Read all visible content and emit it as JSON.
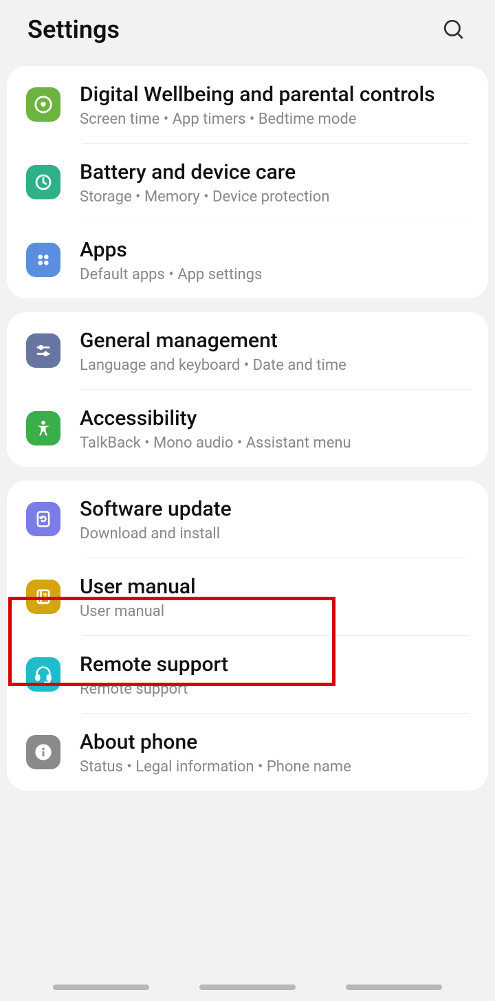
{
  "header": {
    "title": "Settings"
  },
  "groups": [
    {
      "items": [
        {
          "id": "digital-wellbeing",
          "title": "Digital Wellbeing and parental controls",
          "subtitle": "Screen time  •  App timers  •  Bedtime mode",
          "iconColor": "ic-green",
          "iconName": "wellbeing-icon"
        },
        {
          "id": "battery-care",
          "title": "Battery and device care",
          "subtitle": "Storage  •  Memory  •  Device protection",
          "iconColor": "ic-teal-dark",
          "iconName": "battery-icon"
        },
        {
          "id": "apps",
          "title": "Apps",
          "subtitle": "Default apps  •  App settings",
          "iconColor": "ic-blue",
          "iconName": "apps-icon"
        }
      ]
    },
    {
      "items": [
        {
          "id": "general-management",
          "title": "General management",
          "subtitle": "Language and keyboard  •  Date and time",
          "iconColor": "ic-gray-blue",
          "iconName": "sliders-icon"
        },
        {
          "id": "accessibility",
          "title": "Accessibility",
          "subtitle": "TalkBack  •  Mono audio  •  Assistant menu",
          "iconColor": "ic-green2",
          "iconName": "accessibility-icon"
        }
      ]
    },
    {
      "items": [
        {
          "id": "software-update",
          "title": "Software update",
          "subtitle": "Download and install",
          "iconColor": "ic-purple",
          "iconName": "update-icon"
        },
        {
          "id": "user-manual",
          "title": "User manual",
          "subtitle": "User manual",
          "iconColor": "ic-yellow",
          "iconName": "manual-icon"
        },
        {
          "id": "remote-support",
          "title": "Remote support",
          "subtitle": "Remote support",
          "iconColor": "ic-teal",
          "iconName": "headset-icon"
        },
        {
          "id": "about-phone",
          "title": "About phone",
          "subtitle": "Status  •  Legal information  •  Phone name",
          "iconColor": "ic-gray",
          "iconName": "info-icon"
        }
      ]
    }
  ]
}
